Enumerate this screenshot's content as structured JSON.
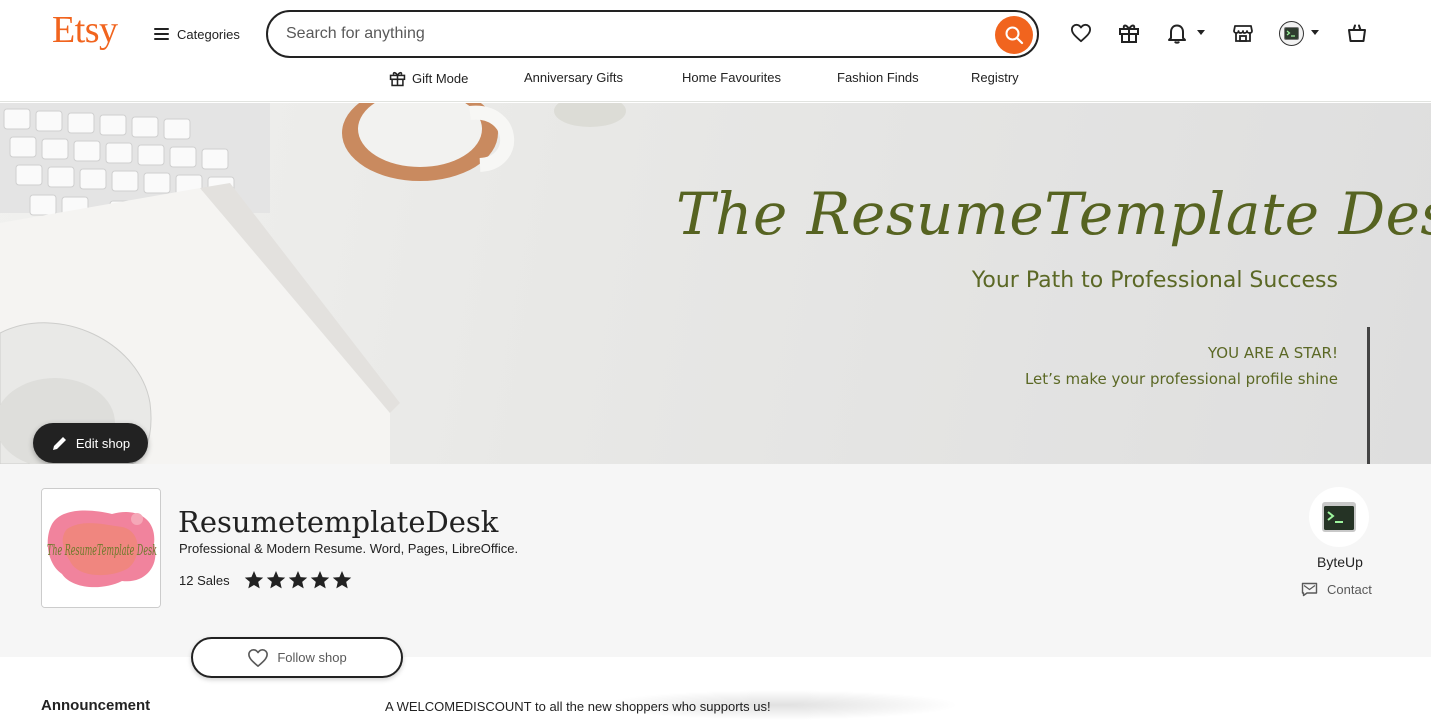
{
  "header": {
    "logo": "Etsy",
    "categories_label": "Categories",
    "search_placeholder": "Search for anything",
    "icons": [
      "heart-icon",
      "gift-icon",
      "bell-icon",
      "shop-icon",
      "avatar",
      "cart-icon"
    ]
  },
  "nav": {
    "items": [
      "Gift Mode",
      "Anniversary Gifts",
      "Home Favourites",
      "Fashion Finds",
      "Registry"
    ]
  },
  "banner": {
    "title": "The ResumeTemplate Desk",
    "subtitle": "Your Path to Professional Success",
    "line1": "YOU ARE A STAR!",
    "line2": "Let’s make your professional profile shine",
    "edit_label": "Edit shop"
  },
  "shop": {
    "logo_text": "The ResumeTemplate Desk",
    "name": "ResumetemplateDesk",
    "tagline": "Professional & Modern Resume. Word, Pages, LibreOffice.",
    "sales": "12 Sales",
    "rating": 5,
    "rating_max": 5,
    "follow_label": "Follow shop"
  },
  "owner": {
    "name": "ByteUp",
    "contact_label": "Contact"
  },
  "announcement": {
    "title": "Announcement",
    "text": "A WELCOMEDISCOUNT to all the new shoppers who supports us!"
  },
  "colors": {
    "brand": "#f1641e",
    "banner_text": "#5b6825",
    "dark": "#222222"
  }
}
